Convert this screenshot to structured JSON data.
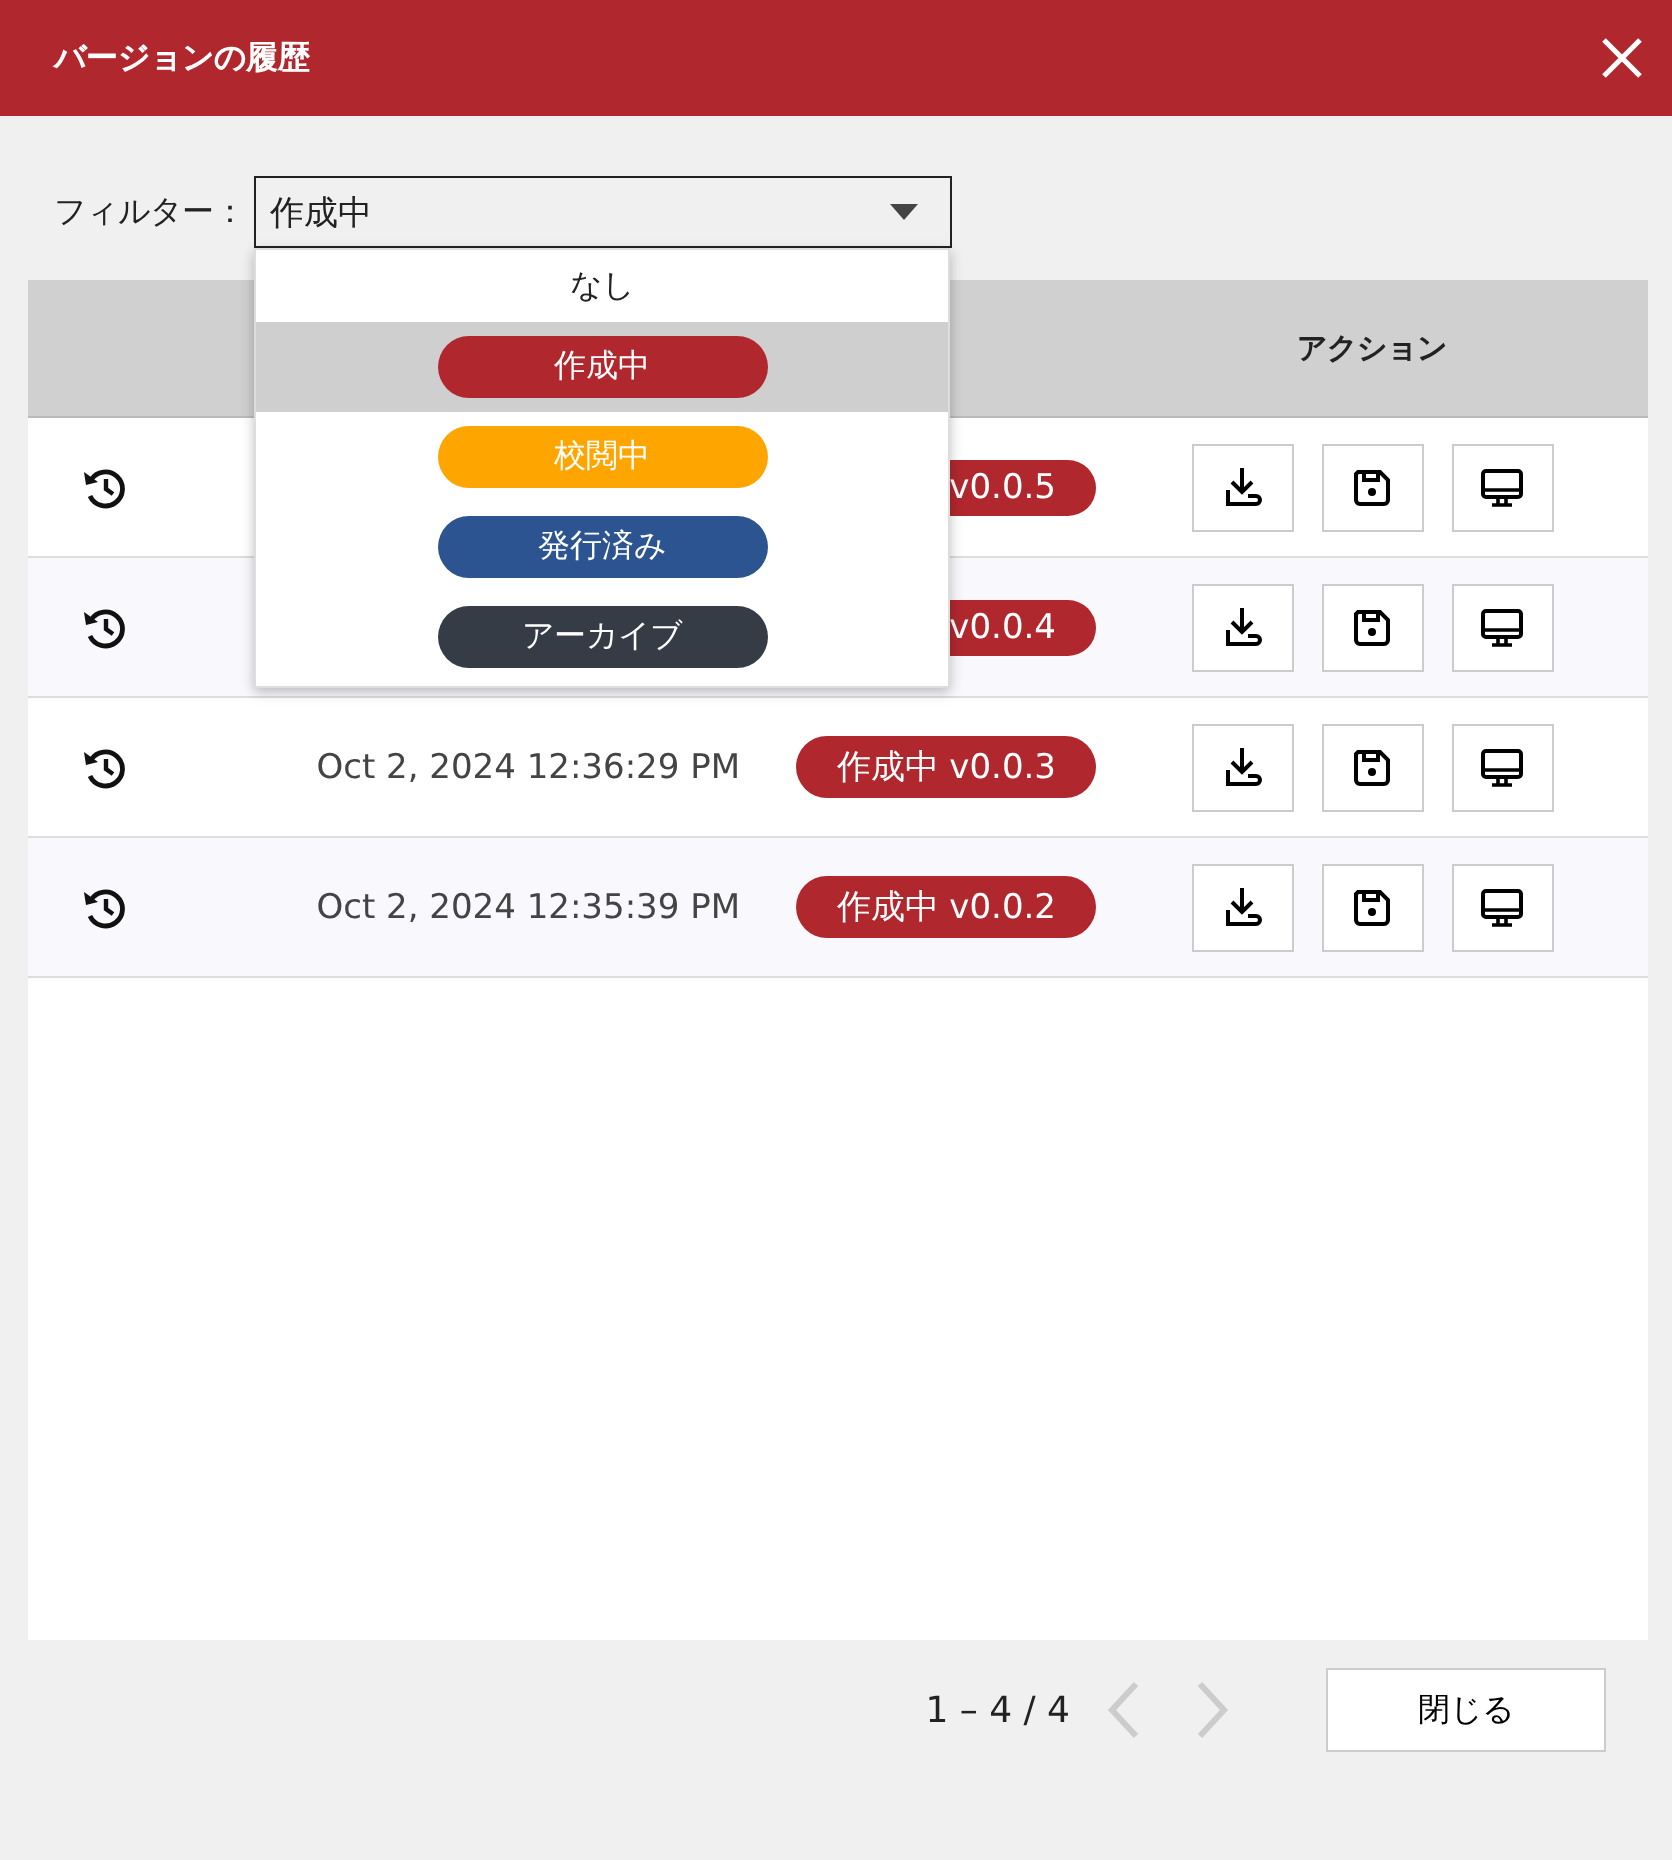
{
  "window": {
    "title": "バージョンの履歴"
  },
  "filter": {
    "label": "フィルター：",
    "value": "作成中",
    "expanded": true,
    "options": [
      {
        "label": "なし",
        "kind": "plain",
        "selected": false
      },
      {
        "label": "作成中",
        "kind": "pill",
        "color": "#b0282e",
        "selected": true
      },
      {
        "label": "校閲中",
        "kind": "pill",
        "color": "#ffa500",
        "selected": false
      },
      {
        "label": "発行済み",
        "kind": "pill",
        "color": "#2c5491",
        "selected": false
      },
      {
        "label": "アーカイブ",
        "kind": "pill",
        "color": "#353c45",
        "selected": false
      }
    ]
  },
  "table": {
    "action_header": "アクション",
    "rows": [
      {
        "badge": "v0.0.5"
      },
      {
        "badge": "v0.0.4"
      },
      {
        "date": "Oct 2, 2024 12:36:29 PM",
        "badge": "作成中 v0.0.3"
      },
      {
        "date": "Oct 2, 2024 12:35:39 PM",
        "badge": "作成中 v0.0.2"
      }
    ]
  },
  "pagination": {
    "range": "1 – 4 / 4",
    "prev_disabled": true,
    "next_disabled": true
  },
  "close_button": "閉じる"
}
